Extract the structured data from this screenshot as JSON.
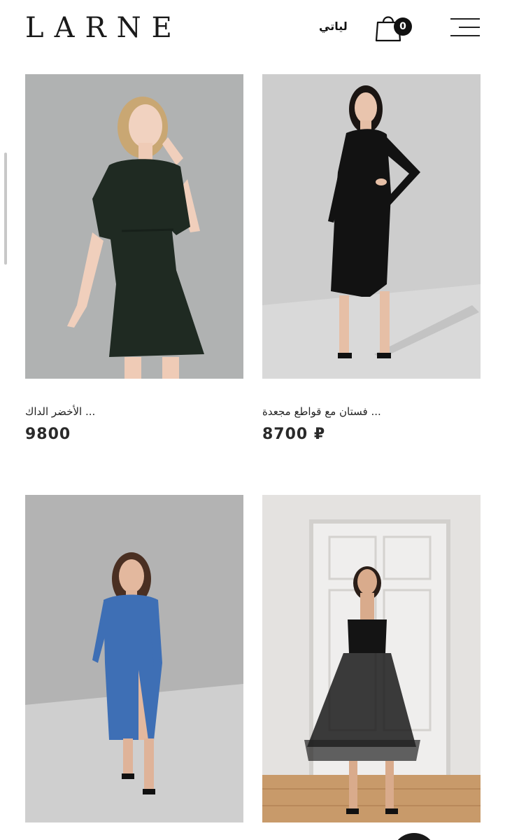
{
  "header": {
    "logo": "LARNE",
    "lang_label": "لياتي",
    "cart_count": "0"
  },
  "icons": {
    "cart": "shopping-bag-icon",
    "menu": "hamburger-menu-icon"
  },
  "products": [
    {
      "title": "... الأخضر الداك",
      "price": "9800",
      "dress_color": "#1f2a22",
      "bg_color": "#a9abab"
    },
    {
      "title": "... فستان مع قواطع مجعدة",
      "price": "8700 ₽",
      "dress_color": "#121212",
      "bg_color": "#cdcdcd"
    },
    {
      "title": "",
      "price": "",
      "dress_color": "#3e6fb5",
      "bg_color": "#b3b3b3"
    },
    {
      "title": "",
      "price": "",
      "dress_color": "#141414",
      "bg_color": "#e4e2e0"
    }
  ]
}
